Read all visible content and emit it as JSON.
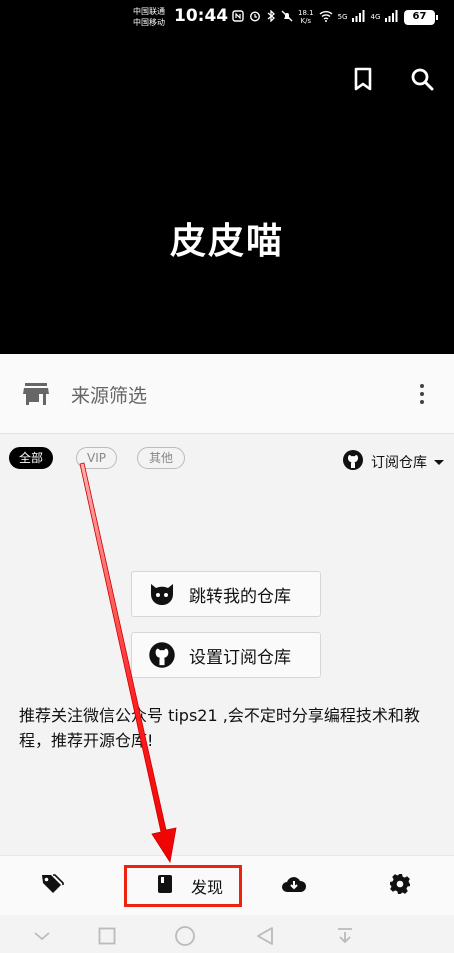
{
  "status_bar": {
    "carrier_1": "中国联通",
    "carrier_2": "中国移动",
    "time": "10:44",
    "net_speed_value": "18.1",
    "net_speed_unit": "K/s",
    "signal_1": "5G",
    "signal_2": "4G",
    "battery": "67"
  },
  "header": {
    "app_title": "皮皮喵"
  },
  "filter_bar": {
    "label": "来源筛选"
  },
  "chips": {
    "all": "全部",
    "vip": "VIP",
    "other": "其他"
  },
  "repo_selector": {
    "label": "订阅仓库"
  },
  "buttons": {
    "jump_repo": "跳转我的仓库",
    "setup_repo": "设置订阅仓库"
  },
  "notice": "推荐关注微信公众号 tips21 ,会不定时分享编程技术和教程，推荐开源仓库!",
  "bottom_nav": {
    "discover": "发现"
  },
  "colors": {
    "annotation": "#e21a1a",
    "header_bg": "#000000",
    "page_bg": "#f3f3f3"
  }
}
